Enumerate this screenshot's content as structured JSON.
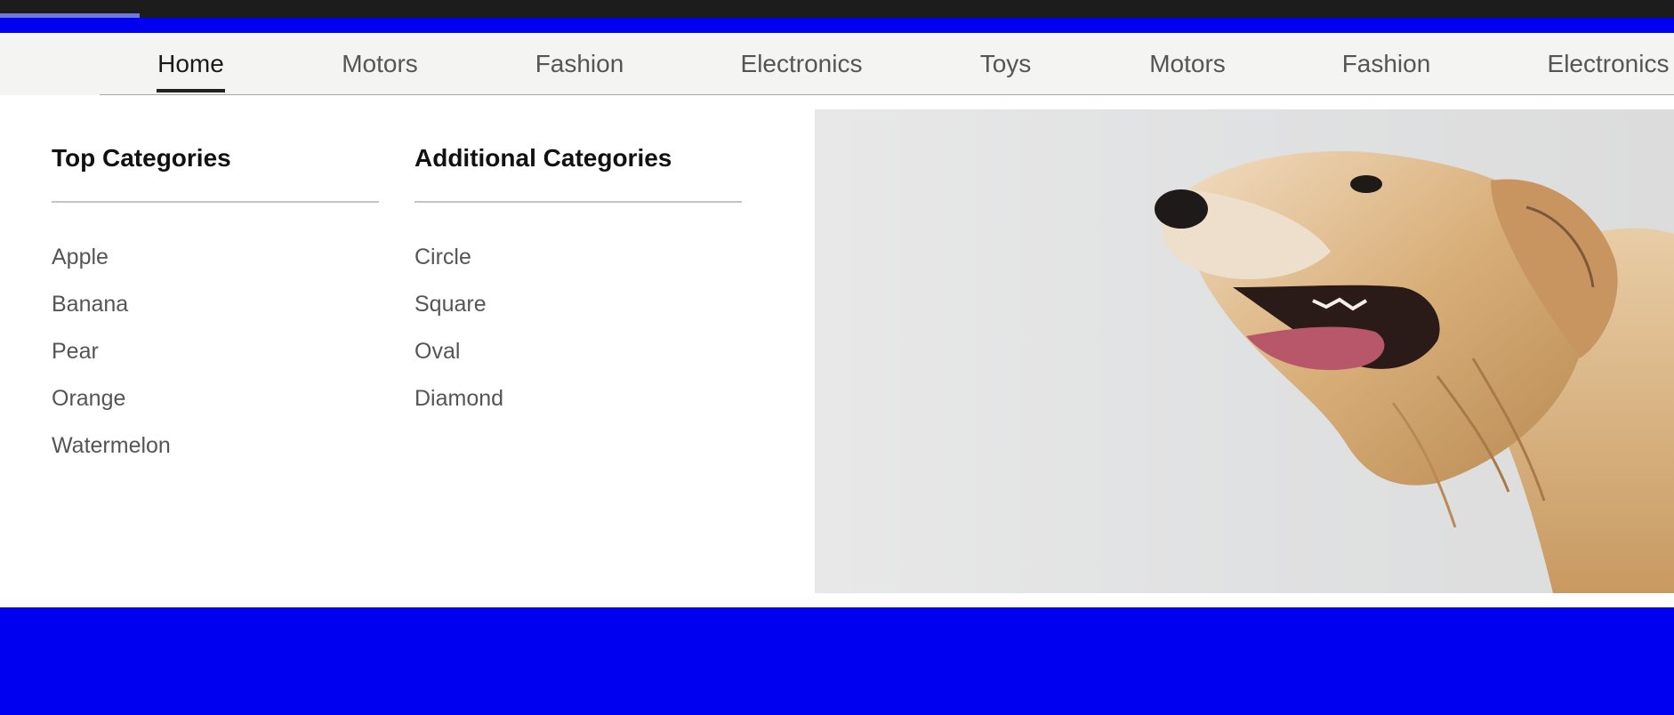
{
  "nav": {
    "items": [
      {
        "label": "Home",
        "active": true
      },
      {
        "label": "Motors",
        "active": false
      },
      {
        "label": "Fashion",
        "active": false
      },
      {
        "label": "Electronics",
        "active": false
      },
      {
        "label": "Toys",
        "active": false
      },
      {
        "label": "Motors",
        "active": false
      },
      {
        "label": "Fashion",
        "active": false
      },
      {
        "label": "Electronics",
        "active": false
      }
    ]
  },
  "menu": {
    "top_categories": {
      "heading": "Top Categories",
      "items": [
        "Apple",
        "Banana",
        "Pear",
        "Orange",
        "Watermelon"
      ]
    },
    "additional_categories": {
      "heading": "Additional Categories",
      "items": [
        "Circle",
        "Square",
        "Oval",
        "Diamond"
      ]
    },
    "promo_image": {
      "subject": "golden-retriever-dog-photo"
    }
  },
  "colors": {
    "accent_blue": "#0000f0",
    "topbar": "#1c1c1c",
    "nav_bg": "#f4f4f2",
    "active_underline": "#222222",
    "loader": "#6f7ad8"
  }
}
